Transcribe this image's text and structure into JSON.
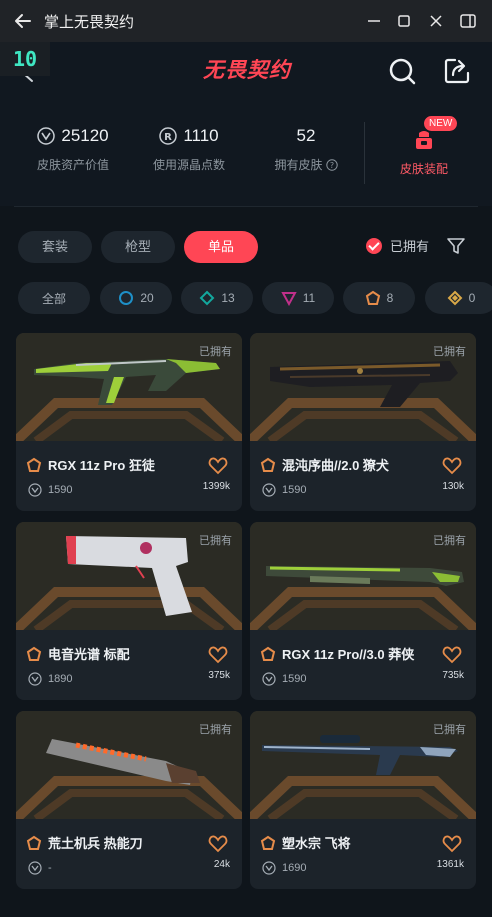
{
  "window": {
    "title": "掌上无畏契约"
  },
  "app": {
    "badge": "10",
    "logo": "无畏契约"
  },
  "stats": {
    "asset_value": {
      "value": "25120",
      "label": "皮肤资产价值"
    },
    "radianite": {
      "value": "1110",
      "label": "使用源晶点数"
    },
    "owned_skins": {
      "value": "52",
      "label": "拥有皮肤"
    },
    "equip": {
      "label": "皮肤装配",
      "new_tag": "NEW"
    }
  },
  "tabs": [
    "套装",
    "枪型",
    "单品"
  ],
  "active_tab": "单品",
  "owned_filter": {
    "label": "已拥有",
    "checked": true
  },
  "tier_chips": [
    {
      "label": "全部",
      "icon": "none"
    },
    {
      "label": "20",
      "icon": "tier-select-icon",
      "color": "#1e90c8"
    },
    {
      "label": "13",
      "icon": "tier-deluxe-icon",
      "color": "#13a89e"
    },
    {
      "label": "11",
      "icon": "tier-premium-icon",
      "color": "#c0308a"
    },
    {
      "label": "8",
      "icon": "tier-exclusive-icon",
      "color": "#e68c4a"
    },
    {
      "label": "0",
      "icon": "tier-ultra-icon",
      "color": "#d8a848"
    }
  ],
  "cards": [
    {
      "name": "RGX 11z Pro 狂徒",
      "price": "1590",
      "likes": "1399k",
      "owned": "已拥有"
    },
    {
      "name": "混沌序曲//2.0 獠犬",
      "price": "1590",
      "likes": "130k",
      "owned": "已拥有"
    },
    {
      "name": "电音光谱 标配",
      "price": "1890",
      "likes": "375k",
      "owned": "已拥有"
    },
    {
      "name": "RGX 11z Pro//3.0 莽侠",
      "price": "1590",
      "likes": "735k",
      "owned": "已拥有"
    },
    {
      "name": "荒土机兵 热能刀",
      "price": "-",
      "likes": "24k",
      "owned": "已拥有"
    },
    {
      "name": "塑水宗 飞将",
      "price": "1690",
      "likes": "1361k",
      "owned": "已拥有"
    }
  ],
  "colors": {
    "accent": "#ff4655",
    "badge_green": "#3fe6c2",
    "tier_orange": "#e68c4a"
  }
}
